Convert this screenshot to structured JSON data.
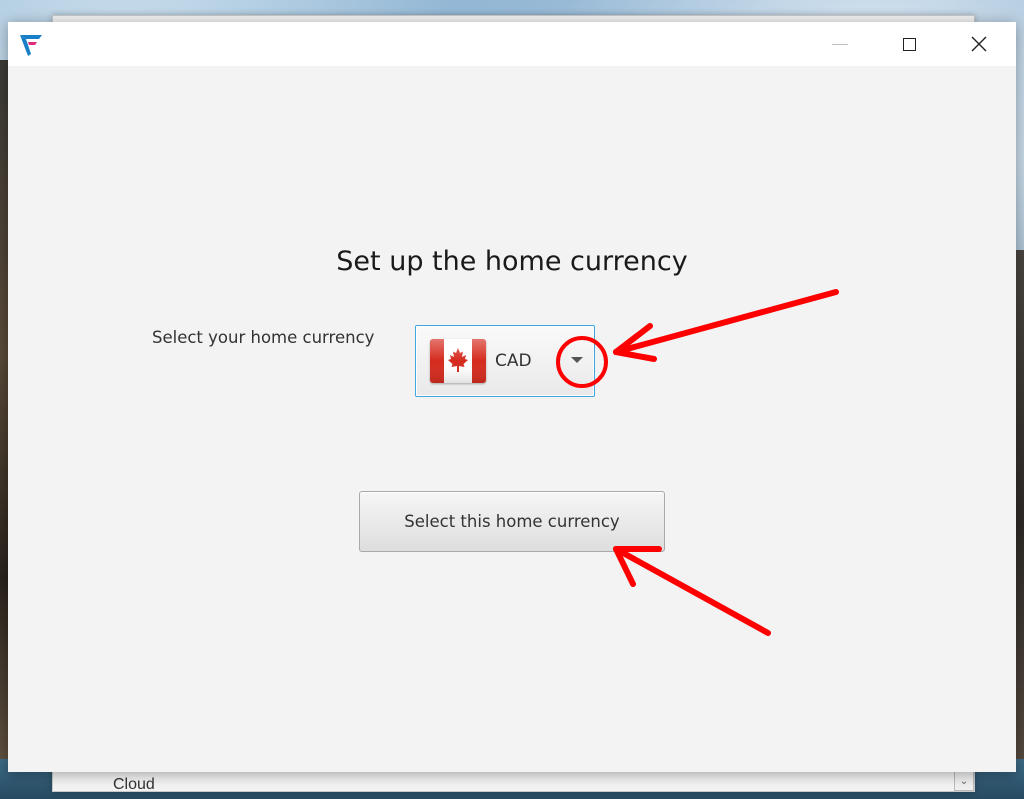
{
  "background_window": {
    "partial_label": "Cloud",
    "scroll_glyph": "⌄"
  },
  "window": {
    "controls": {
      "minimize_icon": "minimize-icon",
      "maximize_icon": "maximize-icon",
      "close_icon": "close-icon"
    },
    "logo_icon": "app-logo-icon"
  },
  "setup": {
    "heading": "Set up the home currency",
    "currency_label": "Select your home currency",
    "selected_currency": {
      "code": "CAD",
      "flag_icon": "canada-flag-icon"
    },
    "submit_label": "Select this home currency"
  },
  "colors": {
    "accent_border": "#3fa7e0",
    "annotation_red": "#ff0000",
    "flag_red": "#d52b1e"
  }
}
